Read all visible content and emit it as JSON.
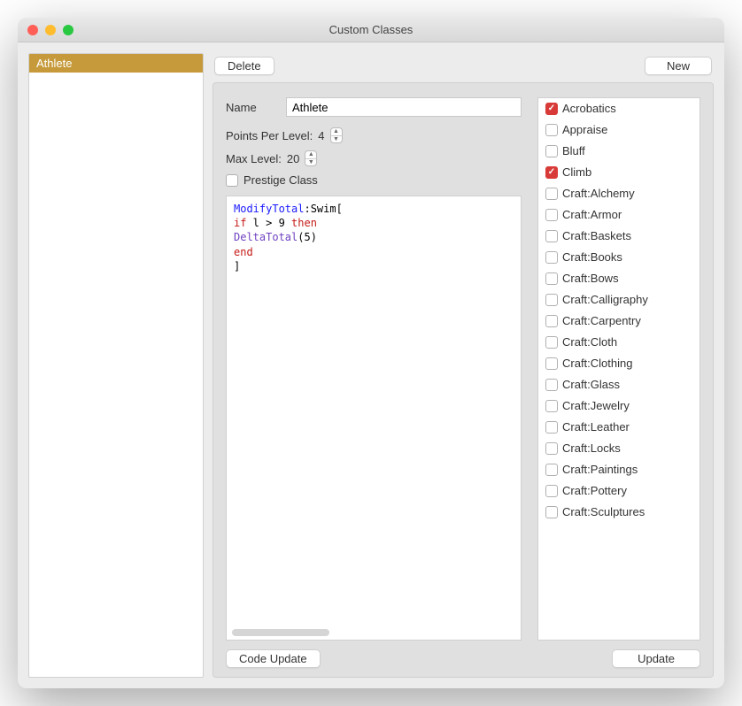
{
  "window": {
    "title": "Custom Classes"
  },
  "sidebar": {
    "items": [
      "Athlete"
    ],
    "selectedIndex": 0
  },
  "buttons": {
    "delete": "Delete",
    "new": "New",
    "codeUpdate": "Code Update",
    "update": "Update"
  },
  "form": {
    "nameLabel": "Name",
    "nameValue": "Athlete",
    "pointsLabel": "Points Per Level:",
    "pointsValue": "4",
    "maxLabel": "Max Level: ",
    "maxValue": "20",
    "prestigeLabel": "Prestige Class",
    "prestigeChecked": false
  },
  "code": {
    "tokens": [
      {
        "t": "ModifyTotal",
        "c": "tok-fn"
      },
      {
        "t": ":Swim[",
        "c": ""
      },
      {
        "t": "\n",
        "c": ""
      },
      {
        "t": "if",
        "c": "tok-kw"
      },
      {
        "t": " l > 9 ",
        "c": ""
      },
      {
        "t": "then",
        "c": "tok-kw"
      },
      {
        "t": "\n",
        "c": ""
      },
      {
        "t": "DeltaTotal",
        "c": "tok-call"
      },
      {
        "t": "(5)",
        "c": ""
      },
      {
        "t": "\n",
        "c": ""
      },
      {
        "t": "end",
        "c": "tok-kw"
      },
      {
        "t": "\n",
        "c": ""
      },
      {
        "t": "]",
        "c": ""
      }
    ]
  },
  "skills": [
    {
      "label": "Acrobatics",
      "checked": true
    },
    {
      "label": "Appraise",
      "checked": false
    },
    {
      "label": "Bluff",
      "checked": false
    },
    {
      "label": "Climb",
      "checked": true
    },
    {
      "label": "Craft:Alchemy",
      "checked": false
    },
    {
      "label": "Craft:Armor",
      "checked": false
    },
    {
      "label": "Craft:Baskets",
      "checked": false
    },
    {
      "label": "Craft:Books",
      "checked": false
    },
    {
      "label": "Craft:Bows",
      "checked": false
    },
    {
      "label": "Craft:Calligraphy",
      "checked": false
    },
    {
      "label": "Craft:Carpentry",
      "checked": false
    },
    {
      "label": "Craft:Cloth",
      "checked": false
    },
    {
      "label": "Craft:Clothing",
      "checked": false
    },
    {
      "label": "Craft:Glass",
      "checked": false
    },
    {
      "label": "Craft:Jewelry",
      "checked": false
    },
    {
      "label": "Craft:Leather",
      "checked": false
    },
    {
      "label": "Craft:Locks",
      "checked": false
    },
    {
      "label": "Craft:Paintings",
      "checked": false
    },
    {
      "label": "Craft:Pottery",
      "checked": false
    },
    {
      "label": "Craft:Sculptures",
      "checked": false
    }
  ]
}
